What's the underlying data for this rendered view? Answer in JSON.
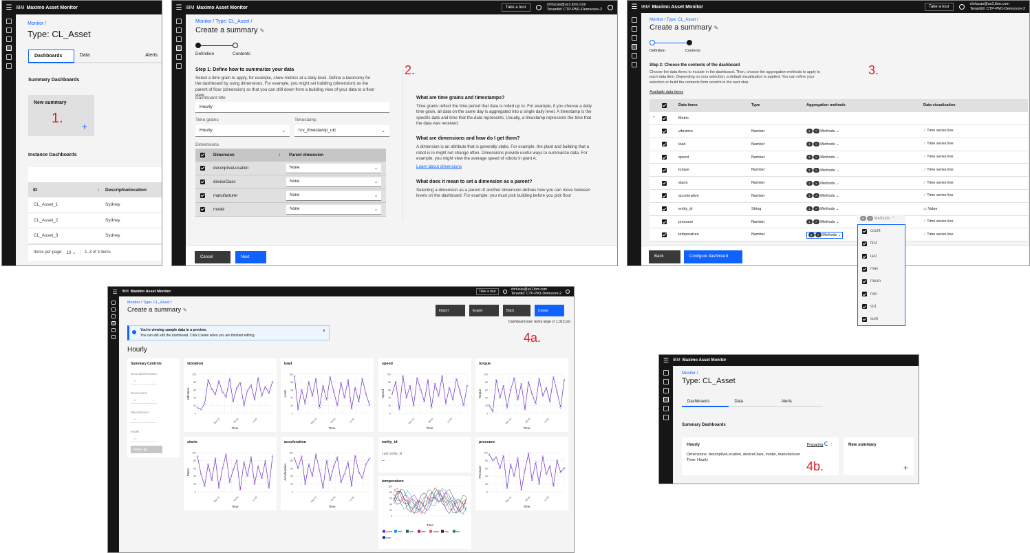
{
  "app": {
    "ibm": "IBM",
    "name": "Maximo Asset Monitor",
    "tour": "Take a tour",
    "user_email": "chrlucas@us1.ibm.com",
    "tenant": "TenantId: CTP-PM1-Democore-2"
  },
  "s1": {
    "breadcrumb": "Monitor",
    "sep": "/",
    "title": "Type: CL_Asset",
    "tabs": [
      "Dashboards",
      "Data",
      "Alerts"
    ],
    "summary_heading": "Summary Dashboards",
    "new_summary": "New summary",
    "plus": "+",
    "instance_heading": "Instance Dashboards",
    "table_headers": [
      "ID",
      "Descriptivelocation"
    ],
    "rows": [
      [
        "CL_Asset_1",
        "Sydney"
      ],
      [
        "CL_Asset_2",
        "Sydney"
      ],
      [
        "CL_Asset_3",
        "Sydney"
      ]
    ],
    "items_per_page": "Items per page:",
    "per_page_value": "10",
    "range": "1–3 of 3 items",
    "step": "1."
  },
  "s2": {
    "bc1": "Monitor",
    "bc2": "Type: CL_Asset",
    "title": "Create a summary",
    "steps": [
      "Definition",
      "Contents"
    ],
    "step_heading": "Step 1: Define how to summarize your data",
    "intro": "Select a time grain to apply, for example, show metrics at a daily level. Define a taxonomy for the dashboard by using dimensions. For example, you might set building (dimension) as the parent of floor (dimension) so that you can drill down from a building view of your data to a floor view.",
    "title_label": "Dashboard title",
    "title_value": "Hourly",
    "grain_label": "Time grains",
    "grain_value": "Hourly",
    "ts_label": "Timestamp",
    "ts_value": "rcv_timestamp_utc",
    "dims_label": "Dimensions",
    "col_dim": "Dimension",
    "col_parent": "Parent dimension",
    "dims": [
      "descriptiveLocation",
      "deviceClass",
      "manufacturer",
      "model"
    ],
    "none": "None",
    "q1": "What are time grains and timestamps?",
    "a1": "Time grains reflect the time period that data is rolled up to. For example, if you choose a daily time grain, all data on the same day is aggregated into a single daily level. A timestamp is the specific date and time that the data represents. Usually, a timestamp represents the time that the data was received.",
    "q2": "What are dimensions and how do I get them?",
    "a2": "A dimension is an attribute that is generally static. For example, the plant and building that a robot is in might not change often. Dimensions provide useful ways to summarize data. For example, you might view the average speed of robots in plant A.",
    "link": "Learn about dimensions",
    "q3": "What does it mean to set a dimension as a parent?",
    "a3": "Selecting a dimension as a parent of another dimension defines how you can move between levels on the dashboard. For example: you must pick building before you pick floor",
    "cancel": "Cancel",
    "next": "Next",
    "step": "2."
  },
  "s3": {
    "bc1": "Monitor",
    "bc2": "Type: CL_Asset",
    "title": "Create a summary",
    "steps": [
      "Definition",
      "Contents"
    ],
    "step_heading": "Step 2: Choose the contents of the dashboard",
    "intro": "Choose the data items to include in the dashboard. Then, choose the aggregation methods to apply to each data item. Depending on your selection, a default visualization is applied. You can refine your selection or build the contents from scratch in the next step.",
    "available": "Available data items",
    "headers": [
      "Data items",
      "Type",
      "Aggregation methods",
      "Data visualization"
    ],
    "group": "Metric",
    "rows": [
      {
        "name": "vibration",
        "type": "Number",
        "count": "1",
        "viz": "Time series line"
      },
      {
        "name": "load",
        "type": "Number",
        "count": "1",
        "viz": "Time series line"
      },
      {
        "name": "speed",
        "type": "Number",
        "count": "1",
        "viz": "Time series line"
      },
      {
        "name": "torque",
        "type": "Number",
        "count": "1",
        "viz": "Time series line"
      },
      {
        "name": "starts",
        "type": "Number",
        "count": "1",
        "viz": "Time series line"
      },
      {
        "name": "acceleration",
        "type": "Number",
        "count": "1",
        "viz": "Time series line"
      },
      {
        "name": "entity_id",
        "type": "String",
        "count": "1",
        "viz": "Value"
      },
      {
        "name": "pressure",
        "type": "Number",
        "count": "1",
        "viz": "Time series line"
      },
      {
        "name": "temperature",
        "type": "Number",
        "count": "8",
        "viz": "Time series line"
      }
    ],
    "methods": "Methods",
    "dropdown_count": "8",
    "dropdown_items": [
      "count",
      "first",
      "last",
      "max",
      "mean",
      "min",
      "std",
      "sum"
    ],
    "back": "Back",
    "configure": "Configure dashboard",
    "step": "3."
  },
  "s4a": {
    "bc1": "Monitor",
    "bc2": "Type: CL_Asset",
    "title": "Create a summary",
    "buttons": [
      "Import",
      "Export",
      "Back",
      "Create"
    ],
    "size_note": "Dashboard size: Extra large (> 1,312 px)",
    "banner_title": "You're viewing sample data in a preview.",
    "banner_text": "You can still edit the dashboard. Click Create when you are finished editing.",
    "dash_title": "Hourly",
    "controls_title": "Summary Controls",
    "controls": [
      "Descriptivelocation",
      "Deviceclass",
      "Manufacturer",
      "Model"
    ],
    "control_value": "All",
    "reset": "Reset all",
    "entity_card": {
      "title": "entity_id",
      "label": "Last entity_id",
      "value": "--"
    },
    "time_label": "Time",
    "legend": [
      "count",
      "first",
      "last",
      "max",
      "mean",
      "min",
      "std",
      "sum"
    ],
    "step": "4a."
  },
  "s4b": {
    "bc": "Monitor",
    "sep": "/",
    "title": "Type: CL_Asset",
    "tabs": [
      "Dashboards",
      "Data",
      "Alerts"
    ],
    "summary_heading": "Summary Dashboards",
    "card_title": "Hourly",
    "status": "Preparing",
    "dims": "Dimensions: descriptiveLocation, deviceClass, model, manufacturer",
    "time": "Time: Hourly",
    "new_summary": "New summary",
    "plus": "+",
    "step": "4b."
  },
  "chart_data": [
    {
      "type": "line",
      "title": "vibration",
      "xlabel": "Time",
      "ylabel": "Vibration",
      "x": [
        "Mar 24",
        "06:00",
        "12:00"
      ],
      "ylim": [
        0,
        100
      ],
      "yticks": [
        0,
        20,
        40,
        60,
        80,
        100
      ],
      "values": [
        15,
        10,
        25,
        85,
        62,
        48,
        82,
        55,
        42,
        88,
        30,
        65,
        78,
        20,
        58,
        72,
        35,
        90,
        45,
        68,
        52,
        80
      ]
    },
    {
      "type": "line",
      "title": "load",
      "xlabel": "Time",
      "ylabel": "Load",
      "x": [
        "Mar 24",
        "06:00",
        "12:00"
      ],
      "ylim": [
        0,
        100
      ],
      "yticks": [
        0,
        20,
        40,
        60,
        80,
        100
      ],
      "values": [
        95,
        10,
        60,
        25,
        80,
        45,
        88,
        15,
        70,
        35,
        92,
        55,
        20,
        78,
        40,
        85,
        12,
        65,
        30,
        88,
        50,
        22
      ]
    },
    {
      "type": "line",
      "title": "speed",
      "xlabel": "Time",
      "ylabel": "Speed",
      "x": [
        "Mar 24",
        "06:00",
        "12:00"
      ],
      "ylim": [
        0,
        100
      ],
      "yticks": [
        0,
        20,
        40,
        60,
        80,
        100
      ],
      "values": [
        50,
        80,
        10,
        95,
        40,
        70,
        20,
        90,
        60,
        30,
        85,
        15,
        75,
        45,
        95,
        25,
        65,
        35,
        88,
        55,
        20,
        70
      ]
    },
    {
      "type": "line",
      "title": "torque",
      "xlabel": "Time",
      "ylabel": "Torque",
      "x": [
        "Mar 24",
        "06:00",
        "12:00"
      ],
      "ylim": [
        0,
        100
      ],
      "yticks": [
        0,
        20,
        40,
        60,
        80,
        100
      ],
      "values": [
        20,
        5,
        85,
        40,
        70,
        15,
        60,
        90,
        35,
        75,
        10,
        80,
        50,
        25,
        88,
        45,
        65,
        30,
        92,
        55,
        15,
        85
      ]
    },
    {
      "type": "line",
      "title": "starts",
      "xlabel": "Time",
      "ylabel": "Starts",
      "x": [
        "Mar 24",
        "06:00",
        "12:00"
      ],
      "ylim": [
        0,
        100
      ],
      "yticks": [
        0,
        20,
        40,
        60,
        80,
        100
      ],
      "values": [
        90,
        45,
        15,
        70,
        30,
        85,
        10,
        60,
        95,
        25,
        55,
        80,
        5,
        75,
        40,
        88,
        20,
        65,
        35,
        78,
        10,
        90
      ]
    },
    {
      "type": "line",
      "title": "acceleration",
      "xlabel": "Time",
      "ylabel": "Acceleration",
      "x": [
        "Mar 24",
        "06:00",
        "12:00"
      ],
      "ylim": [
        0,
        100
      ],
      "yticks": [
        0,
        20,
        40,
        60,
        80,
        100
      ],
      "values": [
        85,
        60,
        90,
        20,
        70,
        40,
        95,
        55,
        10,
        80,
        30,
        65,
        88,
        25,
        45,
        75,
        15,
        92,
        50,
        35,
        70,
        85
      ]
    },
    {
      "type": "line",
      "title": "pressure",
      "xlabel": "Time",
      "ylabel": "Pressure",
      "x": [
        "Mar 24",
        "06:00",
        "12:00"
      ],
      "ylim": [
        0,
        100
      ],
      "yticks": [
        0,
        20,
        40,
        60,
        80,
        100
      ],
      "values": [
        95,
        80,
        88,
        60,
        92,
        10,
        70,
        40,
        85,
        5,
        55,
        98,
        30,
        75,
        20,
        90,
        45,
        65,
        15,
        80,
        50,
        60
      ]
    }
  ]
}
